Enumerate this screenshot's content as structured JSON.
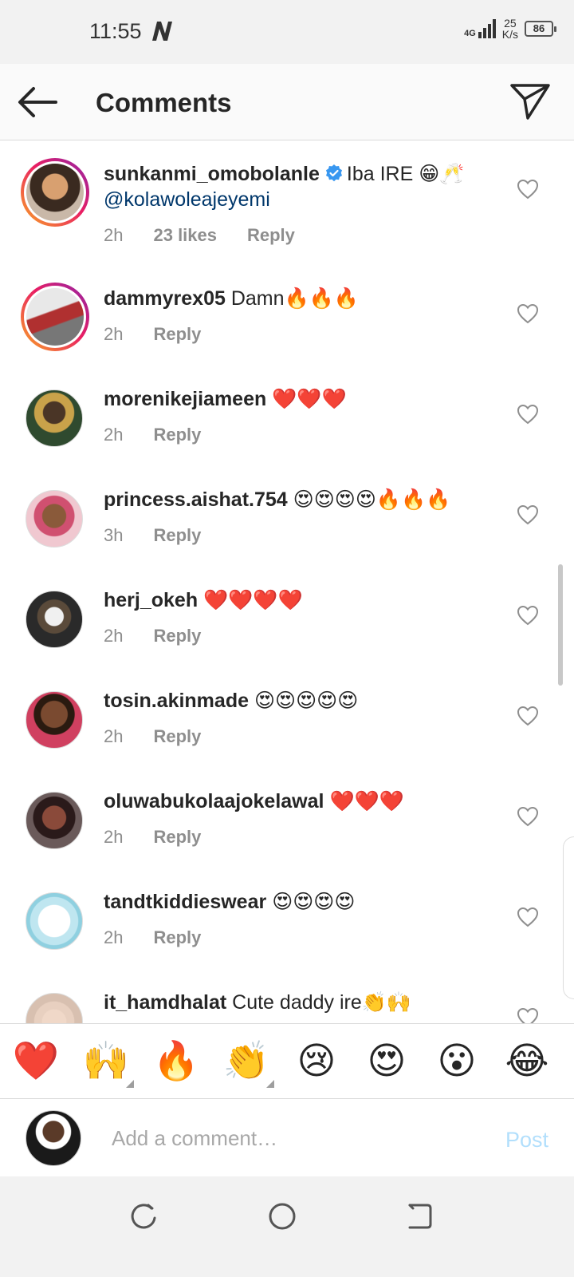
{
  "status_bar": {
    "time": "11:55",
    "network": "4G",
    "speed_value": "25",
    "speed_unit": "K/s",
    "battery": "86"
  },
  "header": {
    "title": "Comments"
  },
  "comments": [
    {
      "user": "sunkanmi_omobolanle",
      "verified": true,
      "text": "Iba IRE 😁🥂",
      "mention": "@kolawoleajeyemi",
      "time": "2h",
      "likes": "23 likes",
      "reply": "Reply"
    },
    {
      "user": "dammyrex05",
      "text": "Damn🔥🔥🔥",
      "time": "2h",
      "reply": "Reply"
    },
    {
      "user": "morenikejiameen",
      "text": "❤️❤️❤️",
      "time": "2h",
      "reply": "Reply"
    },
    {
      "user": "princess.aishat.754",
      "text": "😍😍😍😍🔥🔥🔥",
      "time": "3h",
      "reply": "Reply"
    },
    {
      "user": "herj_okeh",
      "text": "❤️❤️❤️❤️",
      "time": "2h",
      "reply": "Reply"
    },
    {
      "user": "tosin.akinmade",
      "text": "😍😍😍😍😍",
      "time": "2h",
      "reply": "Reply"
    },
    {
      "user": "oluwabukolaajokelawal",
      "text": "❤️❤️❤️",
      "time": "2h",
      "reply": "Reply"
    },
    {
      "user": "tandtkiddieswear",
      "text": "😍😍😍😍",
      "time": "2h",
      "reply": "Reply"
    },
    {
      "user": "it_hamdhalat",
      "text": "Cute daddy ire👏🙌",
      "time": "",
      "reply": ""
    }
  ],
  "emoji_bar": [
    "❤️",
    "🙌",
    "🔥",
    "👏",
    "😢",
    "😍",
    "😮",
    "😂"
  ],
  "composer": {
    "placeholder": "Add a comment…",
    "post_label": "Post"
  },
  "colors": {
    "link": "#00376b",
    "verified": "#3897f0",
    "post_disabled": "#b2dffc",
    "meta": "#8e8e8e"
  }
}
